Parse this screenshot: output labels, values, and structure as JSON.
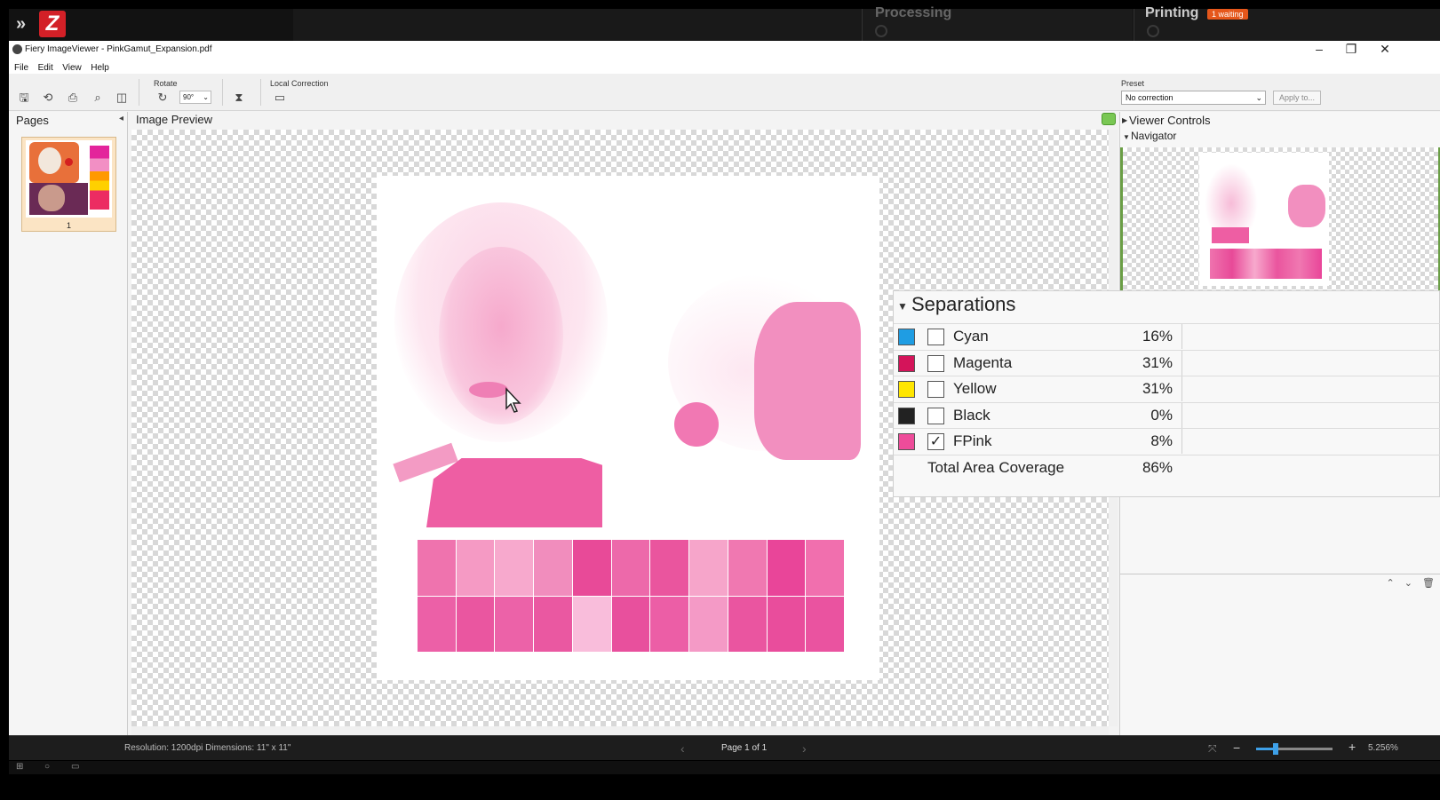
{
  "topbar": {
    "expand_icon": "double-chevron-right-icon",
    "logo_text": "Z",
    "processing_label": "Processing",
    "printing_label": "Printing",
    "printing_badge": "1 waiting",
    "badge_color": "#e5571b"
  },
  "window": {
    "title": "Fiery ImageViewer - PinkGamut_Expansion.pdf",
    "minimize": "–",
    "restore": "❐",
    "close": "✕"
  },
  "menu": [
    "File",
    "Edit",
    "View",
    "Help"
  ],
  "toolbar": {
    "rotate_label": "Rotate",
    "rotate_value": "90°",
    "local_correction_label": "Local Correction",
    "preset_label": "Preset",
    "preset_value": "No correction",
    "apply_label": "Apply to..."
  },
  "pages_panel": {
    "title": "Pages",
    "page_number": "1"
  },
  "preview": {
    "title": "Image Preview"
  },
  "right_panel": {
    "viewer_controls": "Viewer Controls",
    "navigator": "Navigator"
  },
  "separations": {
    "title": "Separations",
    "rows": [
      {
        "name": "Cyan",
        "pct": "16%",
        "color": "#1f9de3",
        "checked": false
      },
      {
        "name": "Magenta",
        "pct": "31%",
        "color": "#d4145a",
        "checked": false
      },
      {
        "name": "Yellow",
        "pct": "31%",
        "color": "#ffe600",
        "checked": false
      },
      {
        "name": "Black",
        "pct": "0%",
        "color": "#222222",
        "checked": false
      },
      {
        "name": "FPink",
        "pct": "8%",
        "color": "#ee4c9a",
        "checked": true
      }
    ],
    "total_label": "Total Area Coverage",
    "total_pct": "86%"
  },
  "status": {
    "info": "Resolution: 1200dpi  Dimensions: 11\" x 11\"",
    "page_label": "Page 1 of 1",
    "zoom_value": "5.256%",
    "zoom_level": 0.25
  },
  "colors": {
    "fpink": "#ec5fa3",
    "light_pink": "#f8b9d6",
    "accent_blue": "#3ea0e8"
  }
}
